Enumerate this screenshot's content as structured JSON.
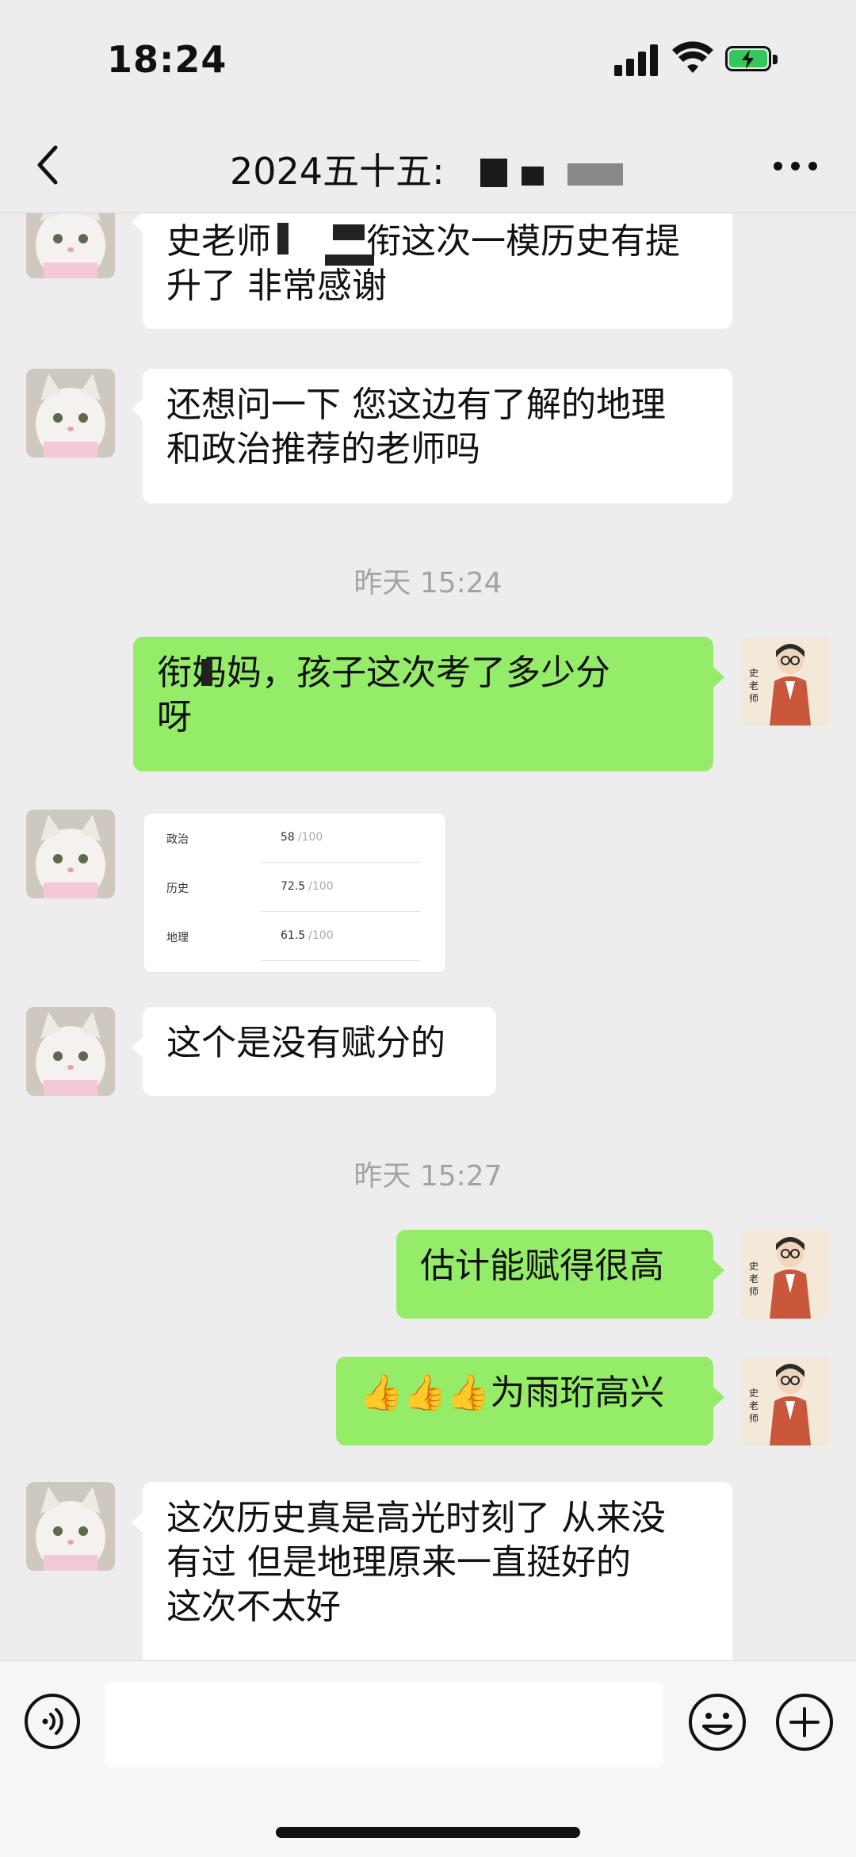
{
  "status_bar": {
    "time": "18:24"
  },
  "header": {
    "title": "2024五十五:"
  },
  "messages": [
    {
      "side": "in",
      "lines": [
        "史老师",
        "衔这次一模历史有提",
        "升了 非常感谢"
      ]
    },
    {
      "side": "in",
      "lines": [
        "还想问一下 您这边有了解的地理",
        "和政治推荐的老师吗"
      ]
    },
    {
      "side": "time",
      "text": "昨天 15:24"
    },
    {
      "side": "out",
      "lines": [
        "衔妈妈，孩子这次考了多少分",
        "呀"
      ]
    },
    {
      "side": "in",
      "type": "score_card",
      "rows": [
        {
          "subject": "政治",
          "score": "58",
          "total": "/100"
        },
        {
          "subject": "历史",
          "score": "72.5",
          "total": "/100"
        },
        {
          "subject": "地理",
          "score": "61.5",
          "total": "/100"
        }
      ]
    },
    {
      "side": "in",
      "lines": [
        "这个是没有赋分的"
      ]
    },
    {
      "side": "time",
      "text": "昨天 15:27"
    },
    {
      "side": "out",
      "lines": [
        "估计能赋得很高"
      ]
    },
    {
      "side": "out",
      "emoji": "👍👍👍",
      "lines": [
        "为雨珩高兴"
      ]
    },
    {
      "side": "in",
      "lines": [
        "这次历史真是高光时刻了 从来没",
        "有过 但是地理原来一直挺好的",
        "这次不太好"
      ]
    }
  ],
  "input_bar": {
    "placeholder": ""
  },
  "colors": {
    "outgoing_bubble": "#95ec69",
    "incoming_bubble": "#ffffff",
    "background": "#ededed",
    "battery": "#34c759"
  },
  "icons": [
    "back-icon",
    "more-icon",
    "voice-icon",
    "emoji-icon",
    "plus-icon"
  ]
}
